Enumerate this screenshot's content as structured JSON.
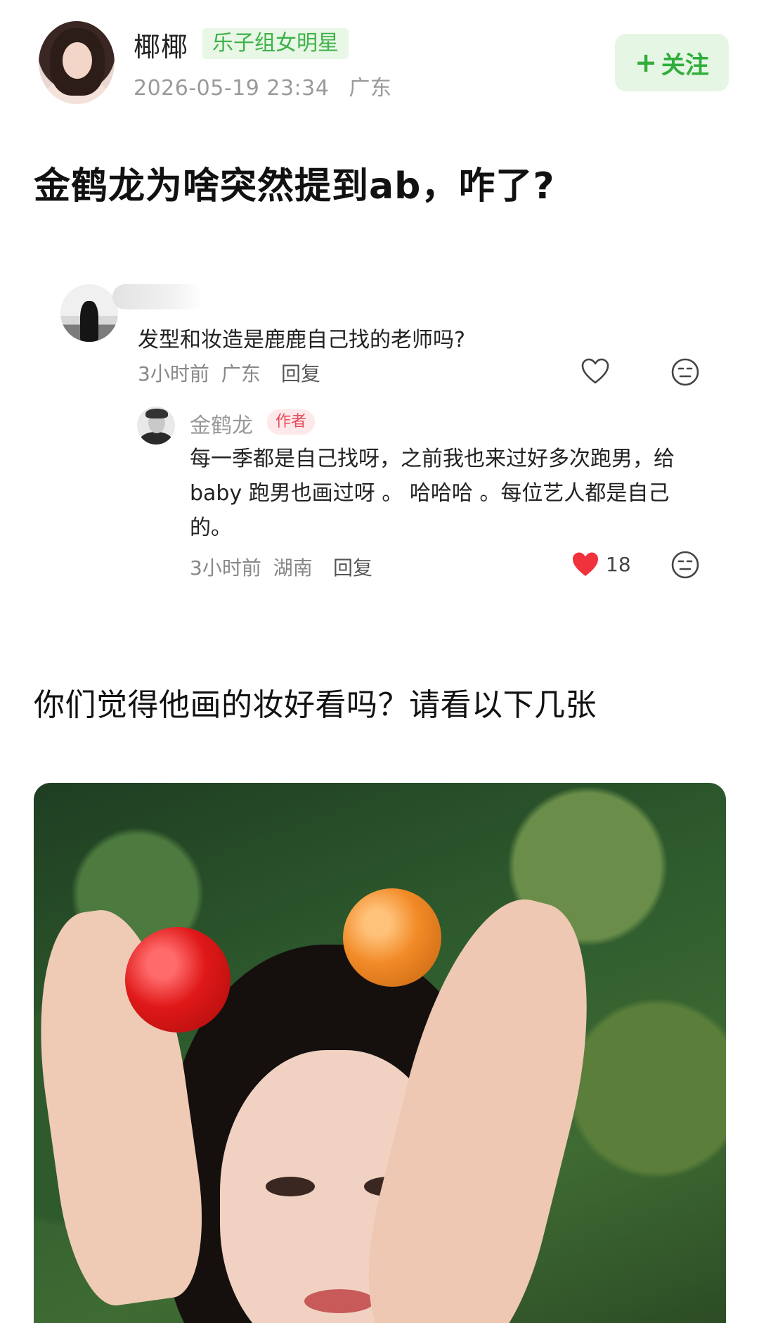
{
  "post": {
    "author": "椰椰",
    "badge": "乐子组女明星",
    "datetime": "2026-05-19 23:34",
    "location": "广东",
    "follow_label": "关注",
    "title": "金鹤龙为啥突然提到ab，咋了?"
  },
  "comment": {
    "text": "发型和妆造是鹿鹿自己找的老师吗?",
    "time": "3小时前",
    "location": "广东",
    "reply_label": "回复",
    "icons": [
      "heart-outline-icon",
      "neutral-face-icon"
    ]
  },
  "author_reply": {
    "name": "金鹤龙",
    "tag": "作者",
    "text": "每一季都是自己找呀，之前我也来过好多次跑男，给 baby 跑男也画过呀 。 哈哈哈 。每位艺人都是自己的。",
    "time": "3小时前",
    "location": "湖南",
    "reply_label": "回复",
    "like_count": "18",
    "icons": [
      "heart-filled-icon",
      "neutral-face-icon"
    ]
  },
  "body": {
    "text": "你们觉得他画的妆好看吗？请看以下几张"
  },
  "colors": {
    "accent_green": "#3fb249",
    "follow_bg": "#e6f6e4",
    "author_tag_red": "#e64b5c",
    "like_red": "#f0323c"
  }
}
